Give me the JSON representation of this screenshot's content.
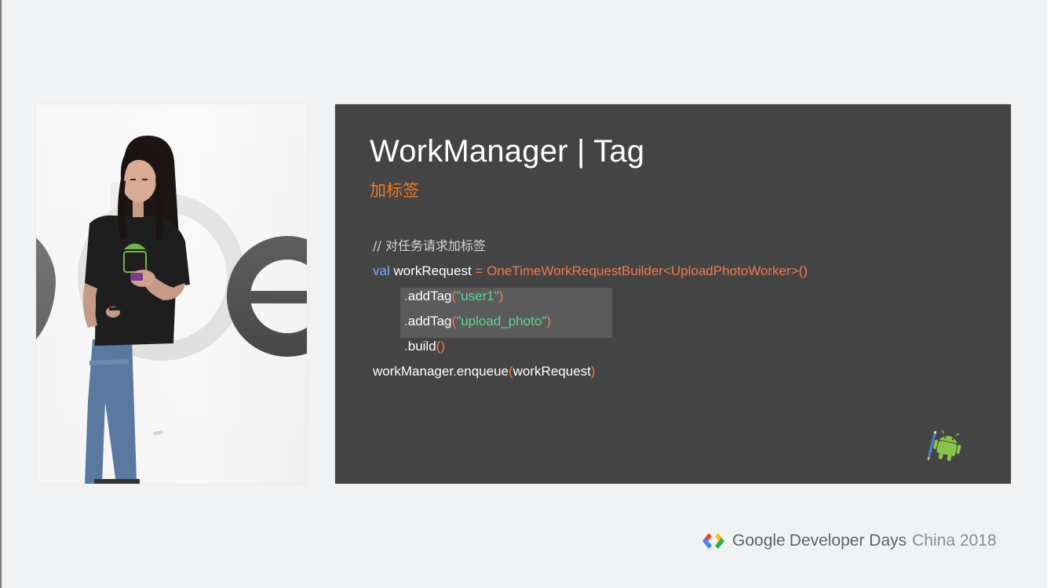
{
  "slide": {
    "title": "WorkManager | Tag",
    "subtitle": "加标签",
    "code": {
      "comment": "// 对任务请求加标签",
      "line2": {
        "keyword": "val",
        "variable": "workRequest",
        "operator": "=",
        "builder": "OneTimeWorkRequestBuilder<UploadPhotoWorker>()"
      },
      "line3": {
        "dot": ".",
        "method": "addTag",
        "open": "(",
        "arg": "\"user1\"",
        "close": ")"
      },
      "line4": {
        "dot": ".",
        "method": "addTag",
        "open": "(",
        "arg": "\"upload_photo\"",
        "close": ")"
      },
      "line5": {
        "dot": ".",
        "method": "build",
        "parens": "()"
      },
      "line6": {
        "object": "workManager",
        "dot": ".",
        "method": "enqueue",
        "open": "(",
        "arg": "workRequest",
        "close": ")"
      }
    }
  },
  "footer": {
    "google": "Google",
    "developer_days": "Developer Days",
    "edition": "China 2018"
  },
  "colors": {
    "slide_background": "#444444",
    "page_background": "#f1f2f4",
    "accent_orange": "#f07b25",
    "keyword_blue": "#7fa8f6",
    "string_green": "#5fd39a"
  },
  "icons": {
    "brand_logo": "gdd-chevrons-logo",
    "slide_mascot": "android-robot-icon"
  }
}
